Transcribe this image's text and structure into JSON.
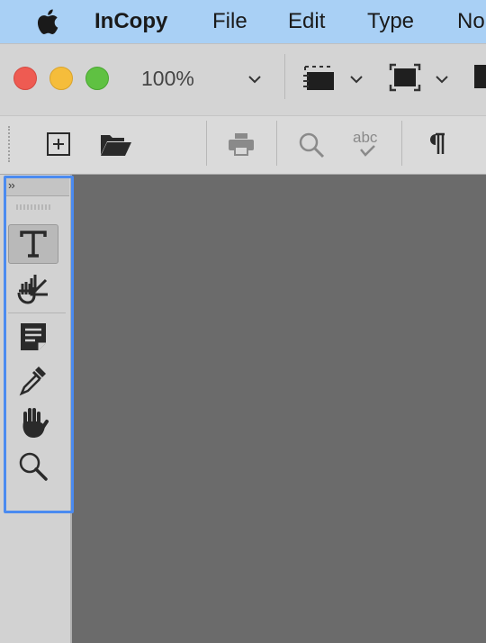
{
  "menubar": {
    "apple_icon": "apple-logo-icon",
    "app_name": "InCopy",
    "items": [
      "File",
      "Edit",
      "Type",
      "No"
    ]
  },
  "window": {
    "zoom_level": "100%",
    "controls": [
      "close",
      "minimize",
      "zoom"
    ]
  },
  "toolbar_icons": [
    "view-mode-icon",
    "screen-mode-icon",
    "new-document-icon",
    "open-folder-icon",
    "print-icon",
    "find-icon",
    "spellcheck-icon",
    "show-hidden-characters-icon"
  ],
  "tools_panel": {
    "collapse_label": "››",
    "tools": [
      {
        "name": "type-tool-icon",
        "active": true
      },
      {
        "name": "position-tool-icon",
        "active": false
      },
      {
        "name": "note-tool-icon",
        "active": false
      },
      {
        "name": "eyedropper-tool-icon",
        "active": false
      },
      {
        "name": "hand-tool-icon",
        "active": false
      },
      {
        "name": "zoom-tool-icon",
        "active": false
      }
    ]
  },
  "colors": {
    "menubar_bg": "#a9d0f5",
    "canvas_bg": "#6b6b6b",
    "selection_outline": "#4b8bf0"
  }
}
